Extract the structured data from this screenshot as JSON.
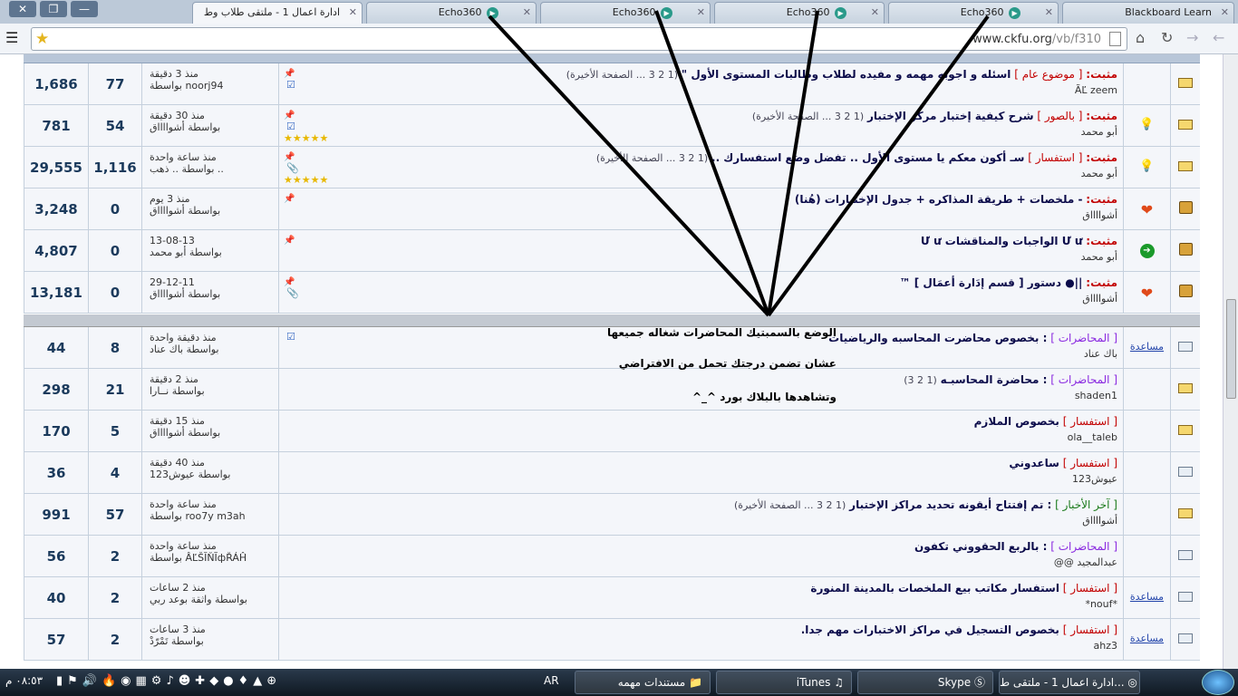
{
  "browser": {
    "tabs": [
      {
        "title": "ادارة اعمال 1 - ملتقى طلاب وط",
        "active": true
      },
      {
        "title": "Echo360"
      },
      {
        "title": "Echo360"
      },
      {
        "title": "Echo360"
      },
      {
        "title": "Echo360"
      },
      {
        "title": "Blackboard Learn"
      }
    ],
    "url_host": "www.ckfu.org",
    "url_path": "/vb/f310"
  },
  "sticky_label": "مثبت:",
  "threads": [
    {
      "views": "1,686",
      "replies": "77",
      "last_time": "منذ 3 دقيقة",
      "last_by": "بواسطة noorj94",
      "prefix": "[ موضوع عام ]",
      "title": "اسئله و اجوبه مهمه و مفيده لطلاب وطالبات المستوى الأول \"",
      "pages": "(1 2 3 ... الصفحة الأخيرة)",
      "author": "ÃĽ zeem",
      "sticky": true,
      "attach": "☑",
      "rating": "",
      "status": "",
      "folder": "hot"
    },
    {
      "views": "781",
      "replies": "54",
      "last_time": "منذ 30 دقيقة",
      "last_by": "بواسطة أشوااااق",
      "prefix": "[ بالصور ]",
      "title": "شرح كيفية إختبار مركز الإختبار",
      "pages": "(1 2 3 ... الصفحة الأخيرة)",
      "author": "أبو محمد",
      "sticky": true,
      "attach": "☑",
      "rating": "★★★★★",
      "status": "bulb",
      "folder": "hot"
    },
    {
      "views": "29,555",
      "replies": "1,116",
      "last_time": "منذ ساعة واحدة",
      "last_by": "بواسطة .. ذهب ..",
      "prefix": "[ استفسار ]",
      "title": "سـ أكون معكم يا مستوى الأول .. تفضل وضع استفسارك ..",
      "pages": "(1 2 3 ... الصفحة الأخيرة)",
      "author": "أبو محمد",
      "sticky": true,
      "attach": "📎",
      "rating": "★★★★★",
      "status": "bulb",
      "folder": "hot"
    },
    {
      "views": "3,248",
      "replies": "0",
      "last_time": "منذ 3 يوم",
      "last_by": "بواسطة أشوااااق",
      "prefix": "",
      "title": "- ملخصات + طريقة المذاكره + جدول الإختبارات (هُنا)",
      "pages": "",
      "author": "أشوااااق",
      "sticky": true,
      "attach": "",
      "rating": "",
      "status": "heart",
      "folder": "lock"
    },
    {
      "views": "4,807",
      "replies": "0",
      "last_time": "13-08-13",
      "last_by": "بواسطة أبو محمد",
      "prefix": "",
      "title": "Ư ư الواجبات والمناقشات Ư ư",
      "pages": "",
      "author": "أبو محمد",
      "sticky": true,
      "attach": "",
      "rating": "",
      "status": "arrow",
      "folder": "lock"
    },
    {
      "views": "13,181",
      "replies": "0",
      "last_time": "29-12-11",
      "last_by": "بواسطة أشوااااق",
      "prefix": "",
      "title": "||● دستور [ قسم إدَارة أعمَال ] ™",
      "pages": "",
      "author": "أشوااااق",
      "sticky": true,
      "attach": "📎",
      "rating": "",
      "status": "heart",
      "folder": "lock"
    },
    {
      "views": "44",
      "replies": "8",
      "last_time": "منذ دقيقة واحدة",
      "last_by": "بواسطة باك عناد",
      "prefix": "[ المحاضرات ]",
      "title": ": بخصوص محاضرت المحاسبه والرياضيات",
      "pages": "",
      "author": "باك عناد",
      "sticky": false,
      "attach": "☑",
      "rating": "",
      "status": "help",
      "folder": "new"
    },
    {
      "views": "298",
      "replies": "21",
      "last_time": "منذ 2 دقيقة",
      "last_by": "بواسطة نــارا",
      "prefix": "[ المحاضرات ]",
      "title": ": محاضرة المحاسبـه",
      "pages": "(1 2 3)",
      "author": "shaden1",
      "sticky": false,
      "attach": "",
      "rating": "",
      "status": "",
      "folder": "hot"
    },
    {
      "views": "170",
      "replies": "5",
      "last_time": "منذ 15 دقيقة",
      "last_by": "بواسطة أشوااااق",
      "prefix": "[ استفسار ]",
      "title": "بخصوص الملازم",
      "pages": "",
      "author": "ola__taleb",
      "sticky": false,
      "attach": "",
      "rating": "",
      "status": "",
      "folder": "hot"
    },
    {
      "views": "36",
      "replies": "4",
      "last_time": "منذ 40 دقيقة",
      "last_by": "بواسطة عيوش123",
      "prefix": "[ استفسار ]",
      "title": "ساعدوني",
      "pages": "",
      "author": "عيوش123",
      "sticky": false,
      "attach": "",
      "rating": "",
      "status": "",
      "folder": "new"
    },
    {
      "views": "991",
      "replies": "57",
      "last_time": "منذ ساعة واحدة",
      "last_by": "بواسطة roo7y m3ah",
      "prefix": "[ آخر الأخبار ]",
      "title": ": تم إفتتاح أيقونه تحديد مراكز الإختبار",
      "pages": "(1 2 3 ... الصفحة الأخيرة)",
      "author": "أشوااااق",
      "sticky": false,
      "attach": "",
      "rating": "",
      "status": "",
      "folder": "hot"
    },
    {
      "views": "56",
      "replies": "2",
      "last_time": "منذ ساعة واحدة",
      "last_by": "بواسطة ÂĽŠĬŇĨфŘÁĤ",
      "prefix": "[ المحاضرات ]",
      "title": ": بالربع الحقووني تكفون",
      "pages": "",
      "author": "عبدالمجيد @@",
      "sticky": false,
      "attach": "",
      "rating": "",
      "status": "",
      "folder": "new"
    },
    {
      "views": "40",
      "replies": "2",
      "last_time": "منذ 2 ساعات",
      "last_by": "بواسطة واثقة بوعد ربي",
      "prefix": "[ استفسار ]",
      "title": "استفسار مكاتب بيع الملخصات بالمدينة المنورة",
      "pages": "",
      "author": "*nouf*",
      "sticky": false,
      "attach": "",
      "rating": "",
      "status": "help",
      "folder": "new"
    },
    {
      "views": "57",
      "replies": "2",
      "last_time": "منذ 3 ساعات",
      "last_by": "بواسطة تَمْرّدْ",
      "prefix": "[ استفسار ]",
      "title": "بخصوص التسجيل في مراكز الاختبارات مهم جدا.",
      "pages": "",
      "author": "ahz3",
      "sticky": false,
      "attach": "",
      "rating": "",
      "status": "help",
      "folder": "new"
    }
  ],
  "help_label": "مساعدة",
  "annotation": {
    "line1": "الوضع بالسمبتيك المحاضرات شغاله جميعها",
    "line2": "عشان تضمن درجتك تحمل من الافتراضي",
    "line3": "وتشاهدها بالبلاك بورد ^_^"
  },
  "taskbar": {
    "items": [
      "ادارة اعمال 1 - ملتقى ط...",
      "Skype",
      "iTunes",
      "مستندات مهمه"
    ],
    "lang": "AR",
    "clock": "٠٨:٥٣ م"
  }
}
